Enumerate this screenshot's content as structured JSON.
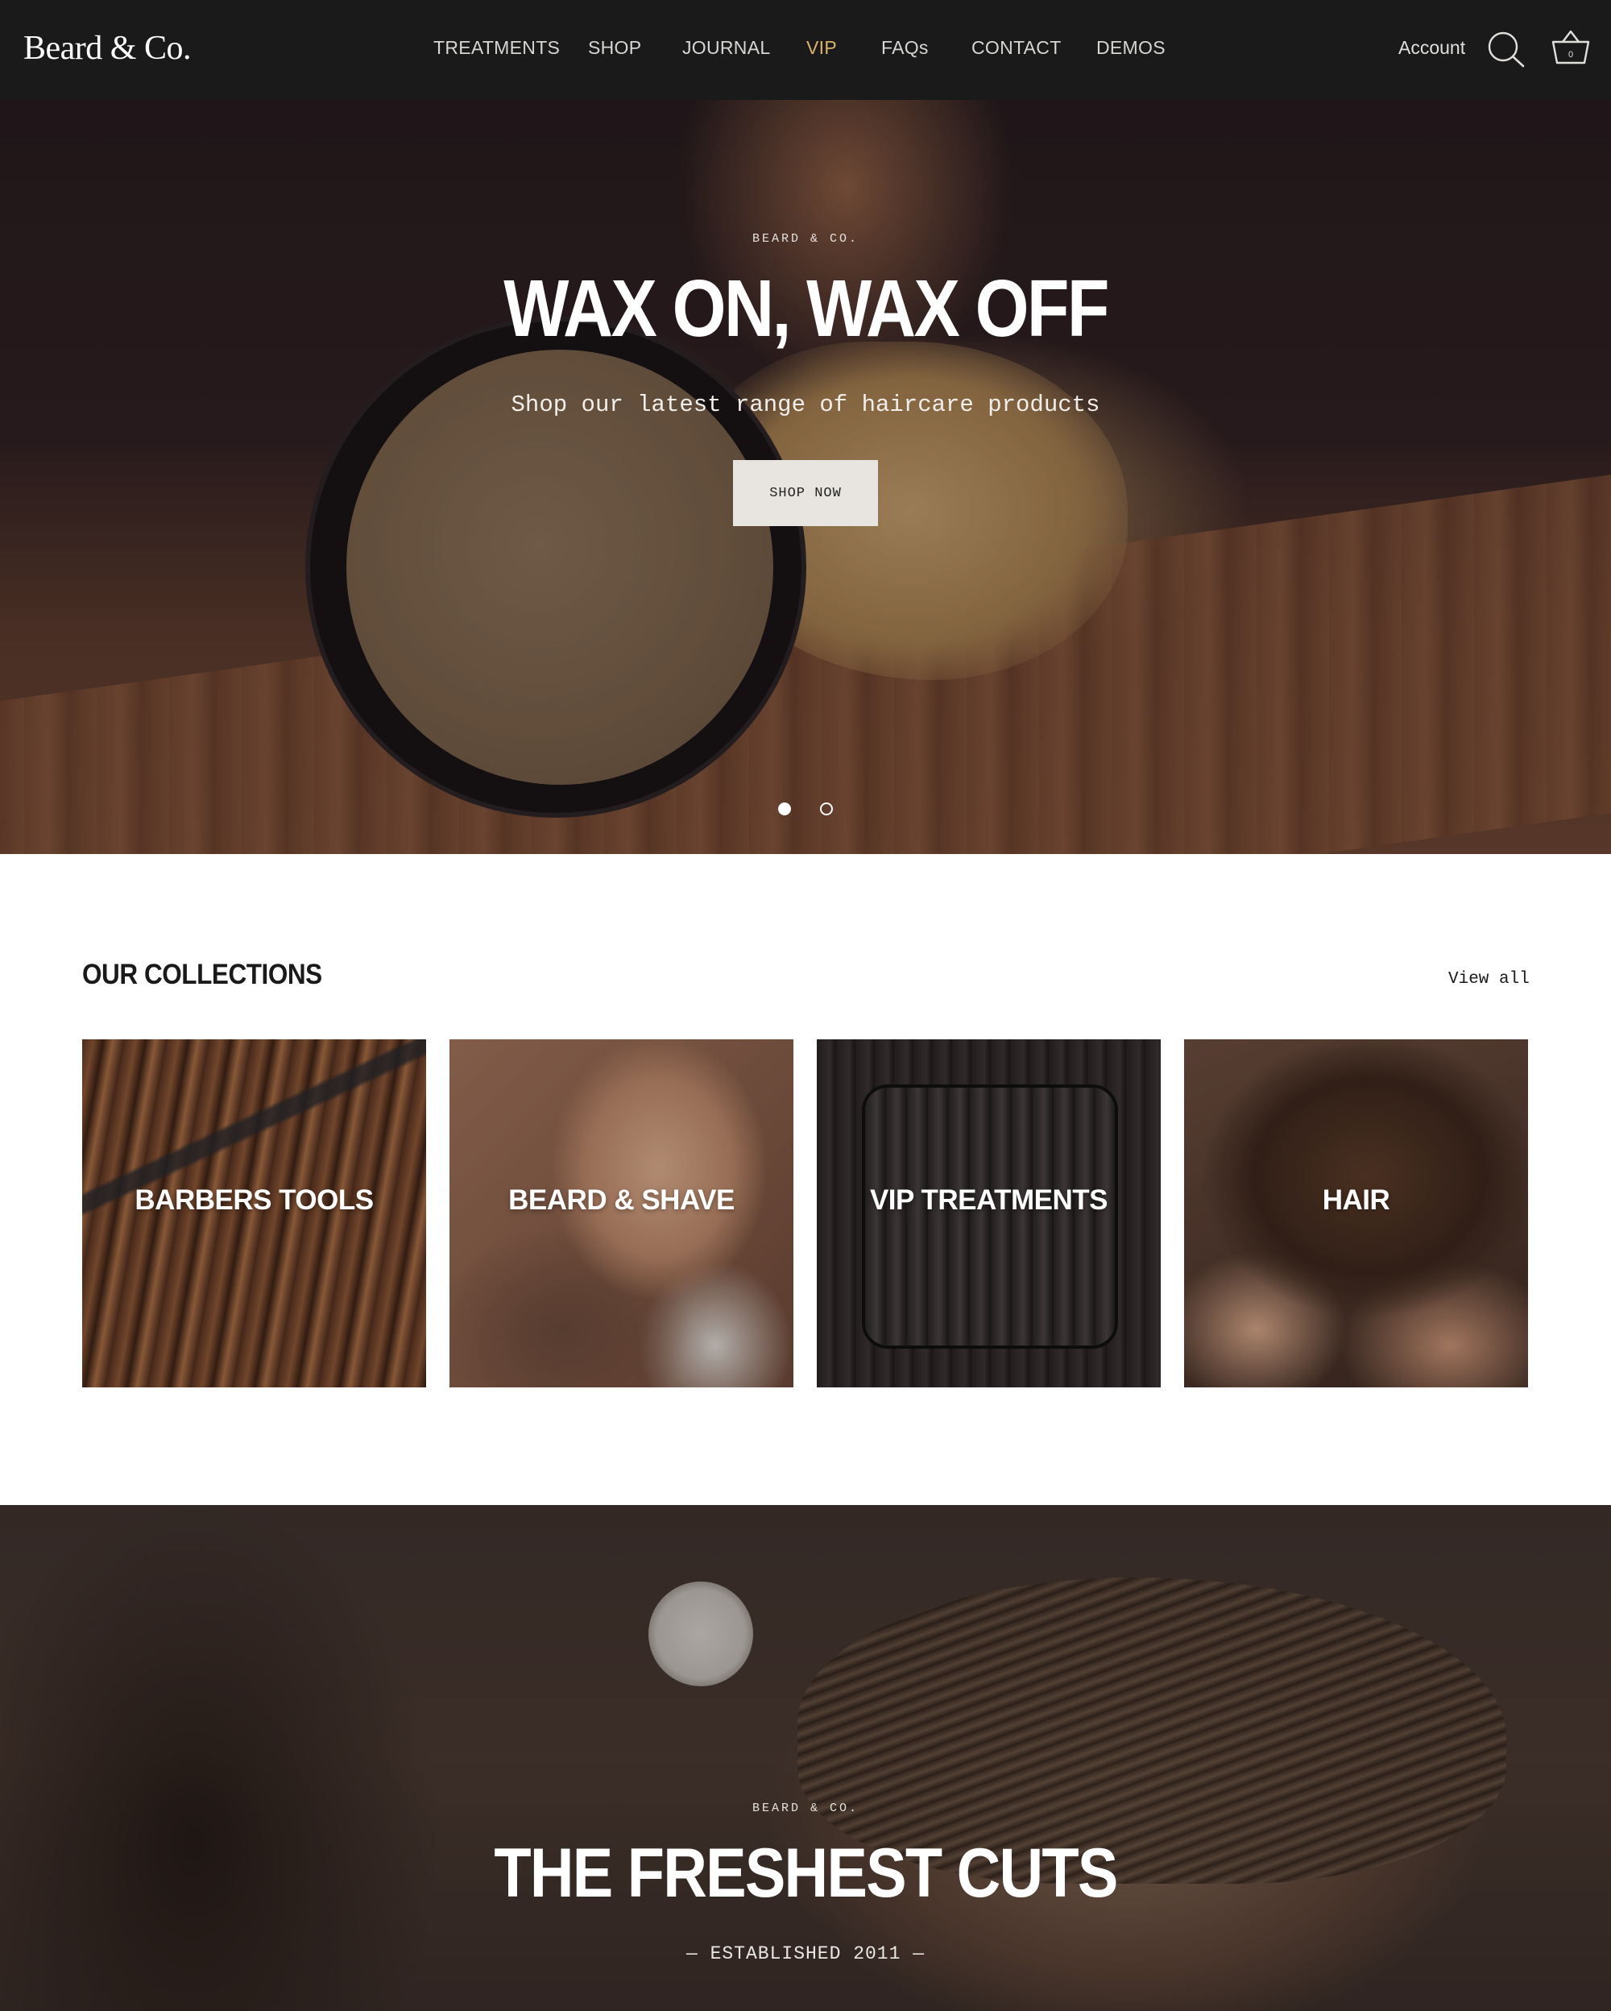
{
  "header": {
    "logo": "Beard & Co.",
    "nav": [
      {
        "label": "TREATMENTS"
      },
      {
        "label": "SHOP"
      },
      {
        "label": "JOURNAL"
      },
      {
        "label": "VIP"
      },
      {
        "label": "FAQs"
      },
      {
        "label": "CONTACT"
      },
      {
        "label": "DEMOS"
      }
    ],
    "account": "Account",
    "cart_count": "0",
    "icons": {
      "search": "search-icon",
      "cart": "basket-icon"
    },
    "colors": {
      "background": "#1b1a1a",
      "vip_accent": "#d9b36d"
    }
  },
  "hero": {
    "eyebrow": "BEARD & CO.",
    "title": "WAX ON, WAX OFF",
    "subtitle": "Shop our latest range of haircare products",
    "button": "SHOP NOW",
    "slides": 2,
    "active_slide": 1
  },
  "collections": {
    "title": "OUR COLLECTIONS",
    "view_all": "View all",
    "items": [
      {
        "label": "BARBERS TOOLS"
      },
      {
        "label": "BEARD & SHAVE"
      },
      {
        "label": "VIP TREATMENTS"
      },
      {
        "label": "HAIR"
      }
    ]
  },
  "banner": {
    "eyebrow": "BEARD & CO.",
    "title": "THE FRESHEST CUTS",
    "subtitle": "— ESTABLISHED 2011 —"
  }
}
